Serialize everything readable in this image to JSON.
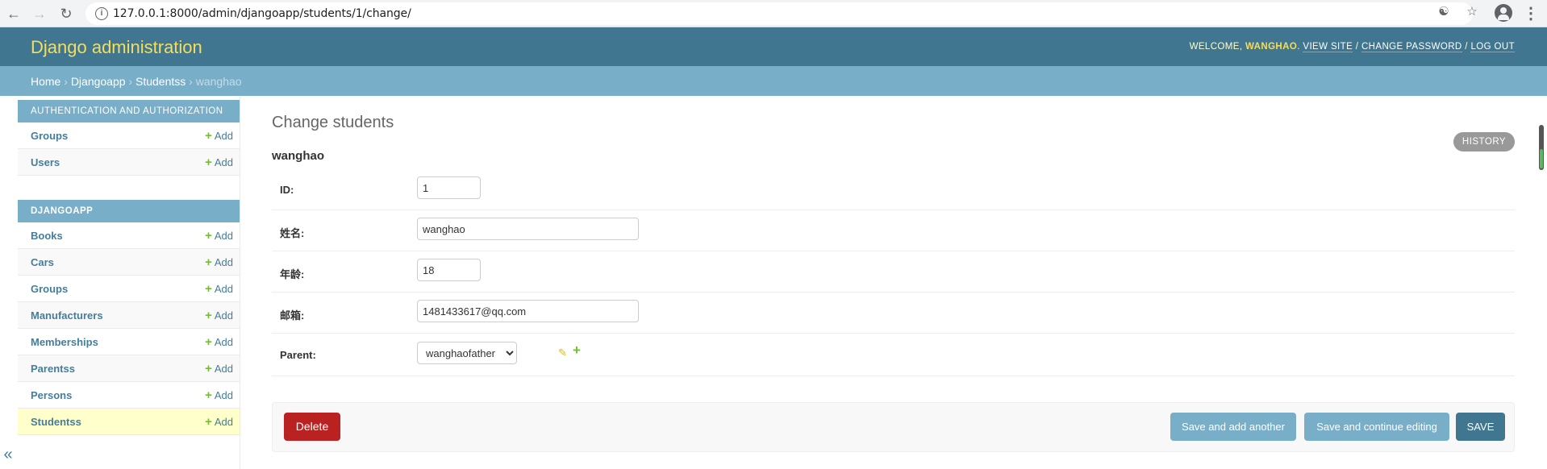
{
  "browser": {
    "url": "127.0.0.1:8000/admin/djangoapp/students/1/change/"
  },
  "header": {
    "branding": "Django administration",
    "welcome": "Welcome,",
    "username": "wanghao",
    "view_site": "View site",
    "change_password": "Change password",
    "log_out": "Log out",
    "sep": "/"
  },
  "breadcrumbs": {
    "home": "Home",
    "app": "Djangoapp",
    "model": "Studentss",
    "current": "wanghao",
    "sep": "›"
  },
  "sidebar": {
    "auth_caption": "Authentication and Authorization",
    "auth_items": [
      {
        "label": "Groups",
        "add": "Add"
      },
      {
        "label": "Users",
        "add": "Add"
      }
    ],
    "app_caption": "Djangoapp",
    "app_items": [
      {
        "label": "Books",
        "add": "Add"
      },
      {
        "label": "Cars",
        "add": "Add"
      },
      {
        "label": "Groups",
        "add": "Add"
      },
      {
        "label": "Manufacturers",
        "add": "Add"
      },
      {
        "label": "Memberships",
        "add": "Add"
      },
      {
        "label": "Parentss",
        "add": "Add"
      },
      {
        "label": "Persons",
        "add": "Add"
      },
      {
        "label": "Studentss",
        "add": "Add"
      }
    ],
    "toggle": "«"
  },
  "main": {
    "title": "Change students",
    "object_title": "wanghao",
    "history": "History",
    "fields": {
      "id": {
        "label": "ID:",
        "value": "1"
      },
      "name": {
        "label": "姓名:",
        "value": "wanghao"
      },
      "age": {
        "label": "年龄:",
        "value": "18"
      },
      "email": {
        "label": "邮箱:",
        "value": "1481433617@qq.com"
      },
      "parent": {
        "label": "Parent:",
        "value": "wanghaofather"
      }
    },
    "buttons": {
      "delete": "Delete",
      "save_add_another": "Save and add another",
      "save_continue": "Save and continue editing",
      "save": "Save"
    }
  },
  "colors": {
    "header_bg": "#417690",
    "breadcrumb_bg": "#79aec8",
    "branding": "#f5dd5d",
    "delete": "#ba2121",
    "add_green": "#70bf2b",
    "current_row": "#ffffcc"
  },
  "icons": {
    "back": "arrow-left-icon",
    "forward": "arrow-right-icon",
    "reload": "reload-icon",
    "info": "info-icon",
    "translate": "translate-icon",
    "bookmark": "star-icon",
    "profile": "avatar-icon",
    "menu": "kebab-menu-icon",
    "change_related": "pencil-icon",
    "add_related": "plus-icon"
  }
}
